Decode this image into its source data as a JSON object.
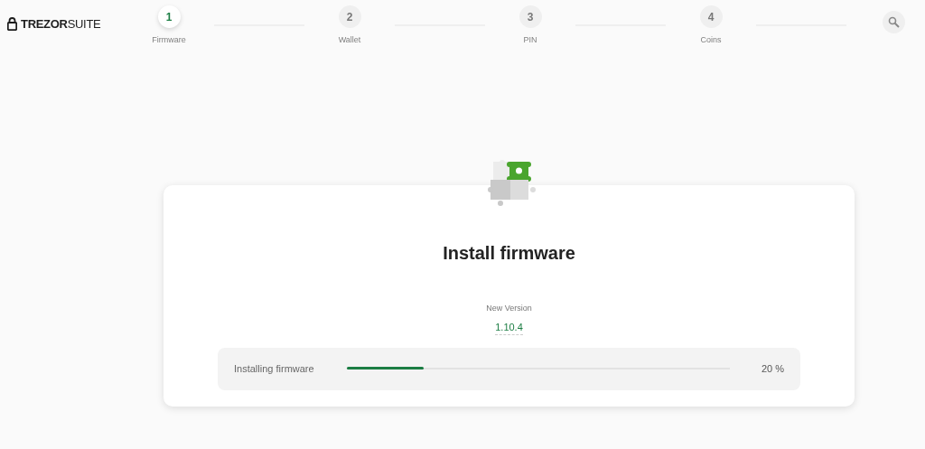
{
  "logo": {
    "text": "**TREZOR**SUITE"
  },
  "steps": [
    {
      "number": "1",
      "label": "Firmware",
      "selected": true
    },
    {
      "number": "2",
      "label": "Wallet",
      "selected": false
    },
    {
      "number": "3",
      "label": "PIN",
      "selected": false
    },
    {
      "number": "4",
      "label": "Coins",
      "selected": false
    }
  ],
  "card": {
    "title": "Install firmware",
    "version_label": "New Version",
    "version": "1.10.4",
    "progress": {
      "label": "Installing firmware",
      "level": 0.2,
      "reading": "20 %"
    }
  }
}
